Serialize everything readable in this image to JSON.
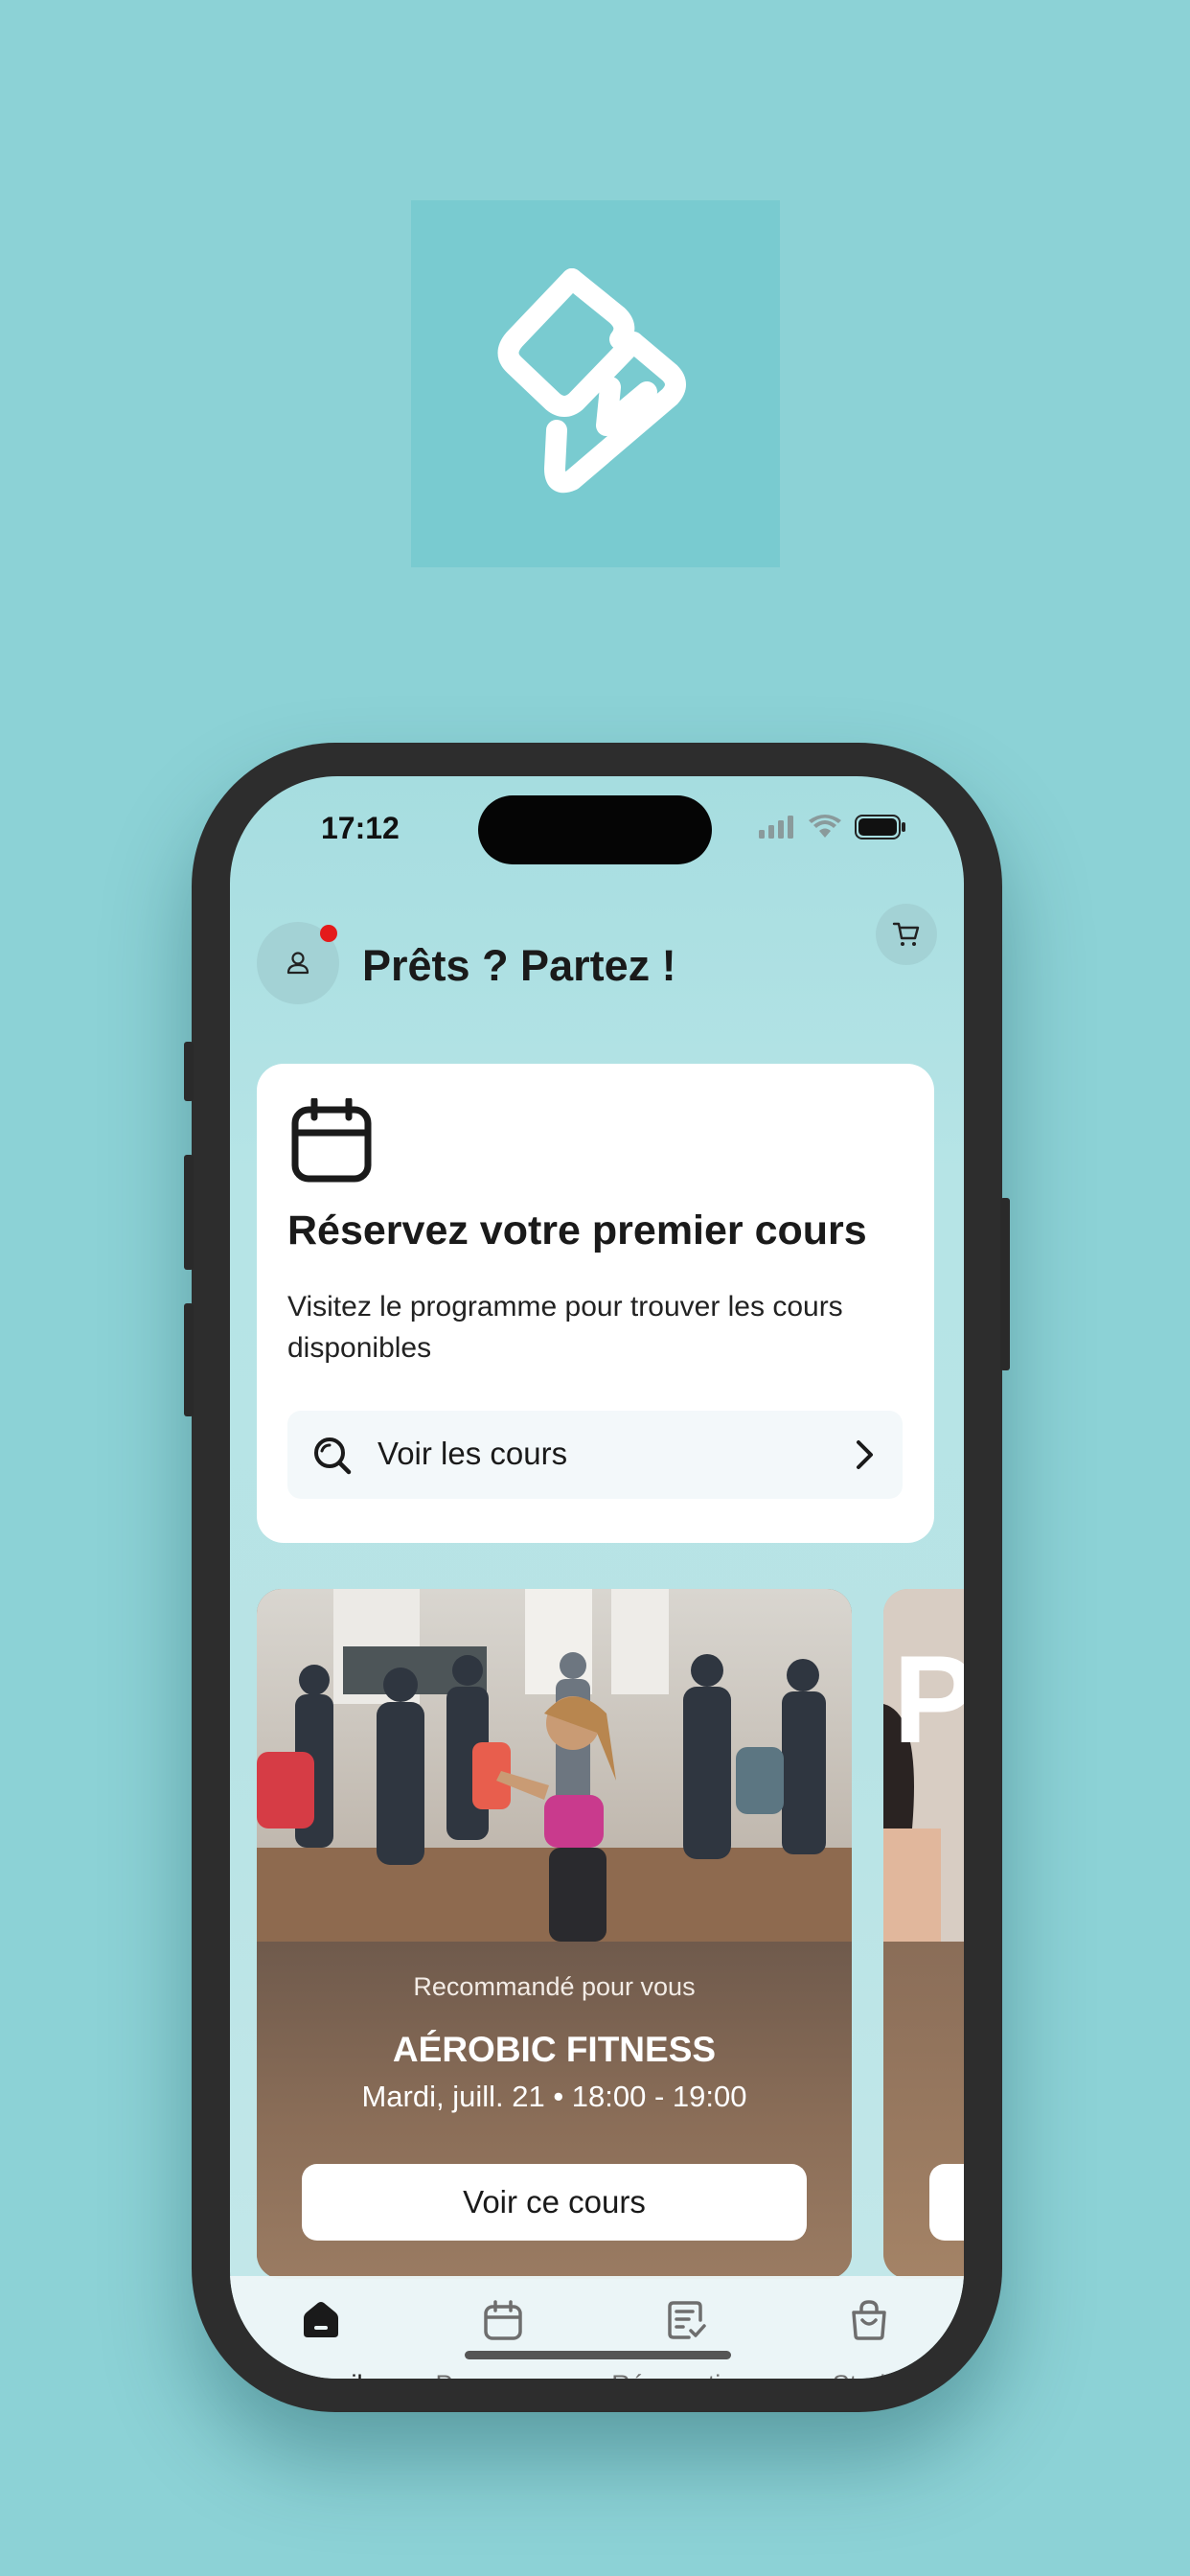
{
  "brand": {
    "logo_icon": "brand-logo-icon",
    "colors": {
      "background": "#8cd2d6",
      "logo_bg": "#79cbd0",
      "notification": "#e41b1b"
    }
  },
  "status_bar": {
    "time": "17:12",
    "icons": [
      "signal-icon",
      "wifi-icon",
      "battery-icon"
    ]
  },
  "header": {
    "greeting": "Prêts ? Partez !",
    "has_notification": true
  },
  "booking_card": {
    "title": "Réservez votre premier cours",
    "description": "Visitez le programme pour trouver les cours disponibles",
    "action_label": "Voir les cours"
  },
  "promo": {
    "tag": "Recommandé pour vous",
    "class_name": "AÉROBIC FITNESS",
    "schedule": "Mardi, juill. 21 • 18:00 - 19:00",
    "button_label": "Voir ce cours",
    "next_card_letter": "P"
  },
  "tab_bar": {
    "items": [
      {
        "label": "Accueil",
        "icon": "home-icon",
        "active": true
      },
      {
        "label": "Programme",
        "icon": "calendar-icon",
        "active": false
      },
      {
        "label": "Réservations",
        "icon": "bookings-icon",
        "active": false
      },
      {
        "label": "Studio",
        "icon": "shopping-bag-icon",
        "active": false
      }
    ]
  }
}
